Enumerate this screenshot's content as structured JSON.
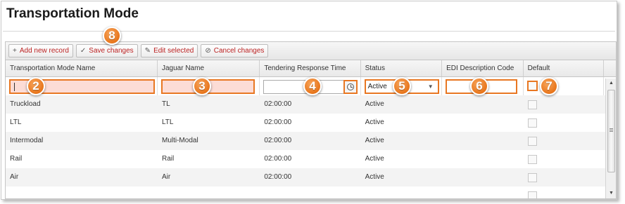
{
  "page": {
    "title": "Transportation Mode"
  },
  "toolbar": {
    "add_label": "Add new record",
    "save_label": "Save changes",
    "edit_label": "Edit selected",
    "cancel_label": "Cancel changes"
  },
  "columns": [
    "Transportation Mode Name",
    "Jaguar Name",
    "Tendering Response Time",
    "Status",
    "EDI Description Code",
    "Default"
  ],
  "edit_row": {
    "status_value": "Active"
  },
  "rows": [
    {
      "name": "Truckload",
      "jaguar": "TL",
      "time": "02:00:00",
      "status": "Active"
    },
    {
      "name": "LTL",
      "jaguar": "LTL",
      "time": "02:00:00",
      "status": "Active"
    },
    {
      "name": "Intermodal",
      "jaguar": "Multi-Modal",
      "time": "02:00:00",
      "status": "Active"
    },
    {
      "name": "Rail",
      "jaguar": "Rail",
      "time": "02:00:00",
      "status": "Active"
    },
    {
      "name": "Air",
      "jaguar": "Air",
      "time": "02:00:00",
      "status": "Active"
    }
  ],
  "callouts": [
    "2",
    "3",
    "4",
    "5",
    "6",
    "7",
    "8"
  ],
  "colors": {
    "accent": "#e87722",
    "button_text": "#bb2222",
    "edit_fill": "#fcdcd6"
  }
}
